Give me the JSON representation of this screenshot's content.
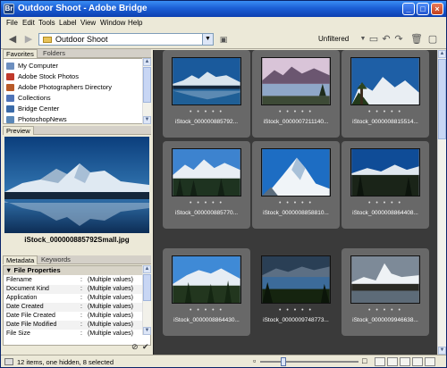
{
  "window": {
    "title": "Outdoor Shoot - Adobe Bridge"
  },
  "menu": [
    "File",
    "Edit",
    "Tools",
    "Label",
    "View",
    "Window",
    "Help"
  ],
  "toolbar": {
    "path": "Outdoor Shoot",
    "filter_label": "Unfiltered"
  },
  "left_tabs": {
    "favorites": "Favorites",
    "folders": "Folders"
  },
  "favorites": [
    {
      "label": "My Computer",
      "color": "#6d8fbf"
    },
    {
      "label": "Adobe Stock Photos",
      "color": "#c0392b"
    },
    {
      "label": "Adobe Photographers Directory",
      "color": "#b85a28"
    },
    {
      "label": "Collections",
      "color": "#4f74b8"
    },
    {
      "label": "Bridge Center",
      "color": "#3a6aa8"
    },
    {
      "label": "PhotoshopNews",
      "color": "#5a88b8"
    }
  ],
  "preview": {
    "tab": "Preview",
    "caption": "iStock_000000885792Small.jpg"
  },
  "meta_tabs": {
    "metadata": "Metadata",
    "keywords": "Keywords"
  },
  "metadata": {
    "section": "File Properties",
    "rows": [
      {
        "key": "Filename",
        "value": "(Multiple values)"
      },
      {
        "key": "Document Kind",
        "value": "(Multiple values)"
      },
      {
        "key": "Application",
        "value": "(Multiple values)"
      },
      {
        "key": "Date Created",
        "value": "(Multiple values)"
      },
      {
        "key": "Date File Created",
        "value": "(Multiple values)"
      },
      {
        "key": "Date File Modified",
        "value": "(Multiple values)"
      },
      {
        "key": "File Size",
        "value": "(Multiple values)"
      }
    ]
  },
  "thumbnails": [
    {
      "name": "iStock_000000885792...",
      "selected": true
    },
    {
      "name": "iStock_0000007211140...",
      "selected": true
    },
    {
      "name": "iStock_0000008815514...",
      "selected": true
    },
    {
      "name": "iStock_000000885770...",
      "selected": true
    },
    {
      "name": "iStock_0000008858810...",
      "selected": true
    },
    {
      "name": "iStock_0000008864408...",
      "selected": true
    },
    {
      "name": "iStock_0000008864430...",
      "selected": true
    },
    {
      "name": "iStock_0000009748773...",
      "selected": false
    },
    {
      "name": "iStock_0000009946638...",
      "selected": true
    }
  ],
  "statusbar": {
    "text": "12 items, one hidden, 8 selected"
  },
  "icons": [
    "back-icon",
    "forward-icon",
    "folder-icon",
    "camera-icon",
    "filter-icon",
    "new-folder-icon",
    "rotate-ccw-icon",
    "rotate-cw-icon",
    "trash-icon"
  ]
}
